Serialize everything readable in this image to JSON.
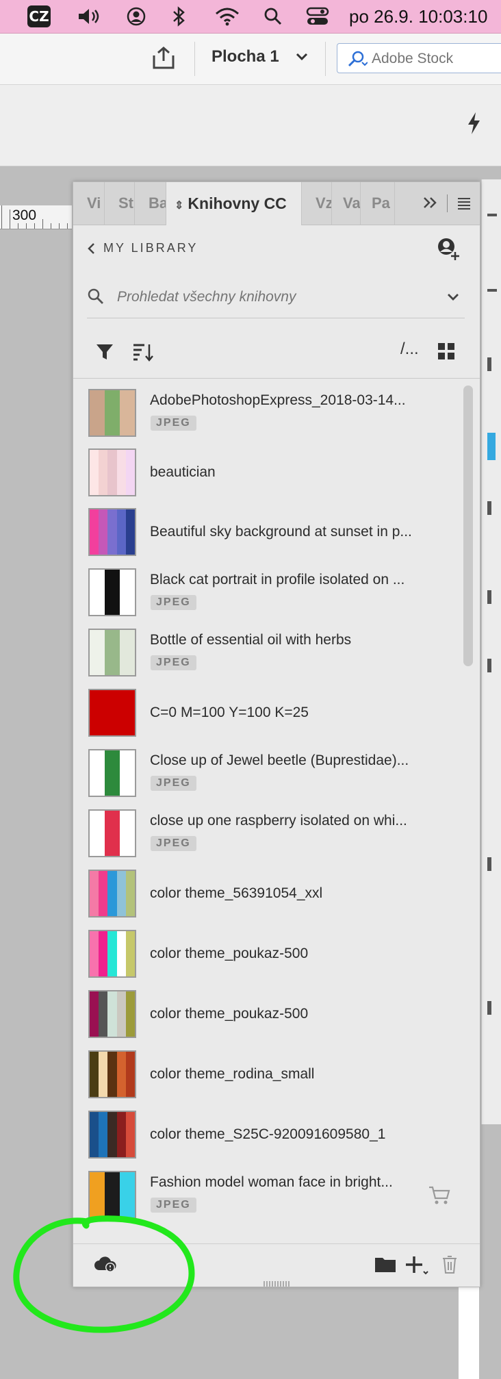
{
  "menubar": {
    "input_source": "CZ",
    "clock": "po 26.9.  10:03:10"
  },
  "toolbar": {
    "document_title": "Plocha 1",
    "stock_search_placeholder": "Adobe Stock"
  },
  "ruler": {
    "label": "300"
  },
  "panel": {
    "tabs": [
      {
        "label": "Vi"
      },
      {
        "label": "St"
      },
      {
        "label": "Ba"
      },
      {
        "label": "Knihovny CC"
      },
      {
        "label": "Vz"
      },
      {
        "label": "Va"
      },
      {
        "label": "Pa"
      }
    ],
    "back_label": "MY LIBRARY",
    "search_placeholder": "Prohledat všechny knihovny",
    "view_toggle_label": "/...",
    "items": [
      {
        "name": "AdobePhotoshopExpress_2018-03-14...",
        "type": "JPEG",
        "thumb": [
          "#c9a48a",
          "#7fae6a",
          "#d9b69a"
        ]
      },
      {
        "name": "beautician",
        "type": "",
        "thumb": [
          "#fde6e6",
          "#f3d2d2",
          "#e8c4cc",
          "#f8dde6",
          "#f3d6f3"
        ]
      },
      {
        "name": "Beautiful sky background at sunset in p...",
        "type": "",
        "thumb": [
          "#f23f9d",
          "#c458b8",
          "#7a6fcf",
          "#5b66c6",
          "#2a3f8f"
        ]
      },
      {
        "name": "Black cat portrait in profile isolated on ...",
        "type": "JPEG",
        "thumb": [
          "#ffffff",
          "#111111",
          "#ffffff"
        ]
      },
      {
        "name": "Bottle of essential oil with herbs",
        "type": "JPEG",
        "thumb": [
          "#eef2ea",
          "#98b88a",
          "#e2e8dc"
        ]
      },
      {
        "name": "C=0 M=100 Y=100 K=25",
        "type": "",
        "thumb": [
          "#cc0000"
        ]
      },
      {
        "name": "Close up of Jewel beetle (Buprestidae)...",
        "type": "JPEG",
        "thumb": [
          "#ffffff",
          "#2d8a3c",
          "#ffffff"
        ]
      },
      {
        "name": "close up one raspberry isolated on whi...",
        "type": "JPEG",
        "thumb": [
          "#ffffff",
          "#e0304c",
          "#ffffff"
        ]
      },
      {
        "name": "color theme_56391054_xxl",
        "type": "",
        "thumb": [
          "#f47aa6",
          "#f03b8c",
          "#2b98d9",
          "#8fc2d8",
          "#b3c27a"
        ]
      },
      {
        "name": "color theme_poukaz-500",
        "type": "",
        "thumb": [
          "#f872ad",
          "#f0208d",
          "#27e6d6",
          "#ffffff",
          "#c6c86a"
        ]
      },
      {
        "name": "color theme_poukaz-500",
        "type": "",
        "thumb": [
          "#9a1052",
          "#555555",
          "#cfe2d8",
          "#cbc8c0",
          "#9c9b3a"
        ]
      },
      {
        "name": "color theme_rodina_small",
        "type": "",
        "thumb": [
          "#4b3d13",
          "#f3d9ad",
          "#5b3211",
          "#d4622e",
          "#b13a1c"
        ]
      },
      {
        "name": "color theme_S25C-920091609580_1",
        "type": "",
        "thumb": [
          "#1a4f8a",
          "#1e73b8",
          "#3b2a24",
          "#8b1e1e",
          "#d64b3a"
        ]
      },
      {
        "name": "Fashion model woman face in bright...",
        "type": "JPEG",
        "thumb": [
          "#f0a020",
          "#1c1c1c",
          "#39d1e8"
        ]
      }
    ]
  }
}
